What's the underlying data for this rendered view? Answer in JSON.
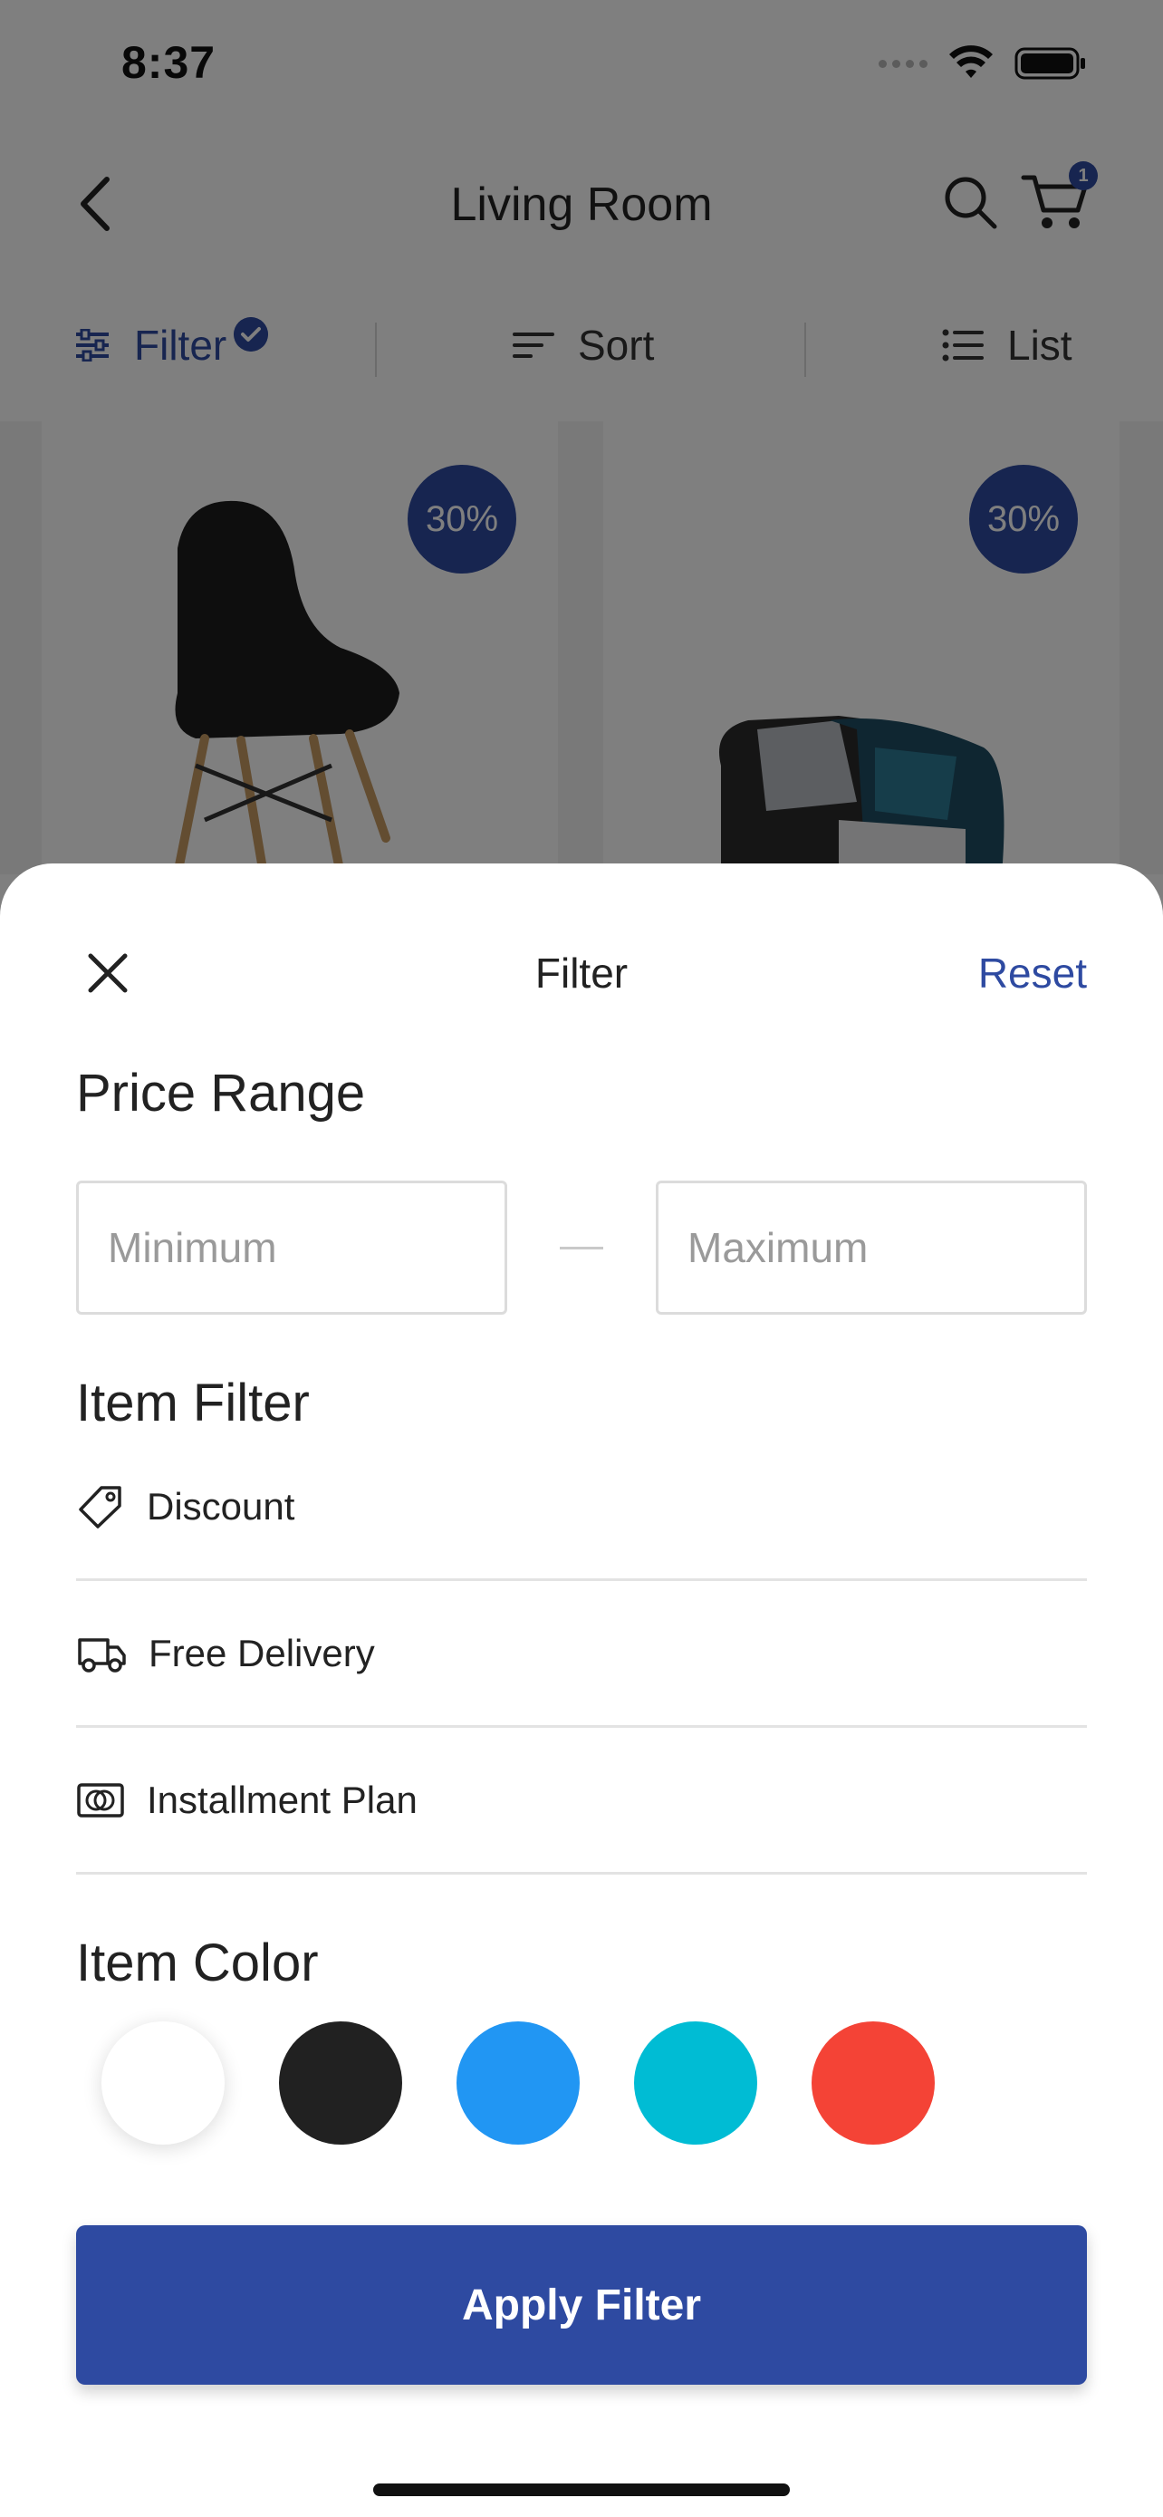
{
  "status_bar": {
    "time": "8:37"
  },
  "nav": {
    "title": "Living Room",
    "cart_count": "1"
  },
  "toolbar": {
    "filter_label": "Filter",
    "sort_label": "Sort",
    "list_label": "List"
  },
  "products": [
    {
      "discount": "30%",
      "image": "black-chair"
    },
    {
      "discount": "30%",
      "image": "patchwork-armchair"
    }
  ],
  "sheet": {
    "title": "Filter",
    "reset_label": "Reset",
    "price_range": {
      "title": "Price Range",
      "min_placeholder": "Minimum",
      "max_placeholder": "Maximum"
    },
    "item_filter": {
      "title": "Item Filter",
      "items": [
        {
          "label": "Discount",
          "icon": "tag-icon"
        },
        {
          "label": "Free Delivery",
          "icon": "truck-icon"
        },
        {
          "label": "Installment Plan",
          "icon": "installment-icon"
        }
      ]
    },
    "item_color": {
      "title": "Item Color",
      "colors": [
        "#ffffff",
        "#212121",
        "#2196f3",
        "#00bcd4",
        "#f44336"
      ]
    },
    "apply_label": "Apply Filter"
  },
  "colors": {
    "accent": "#2e4aa1",
    "overlay": "rgba(0,0,0,0.5)"
  }
}
